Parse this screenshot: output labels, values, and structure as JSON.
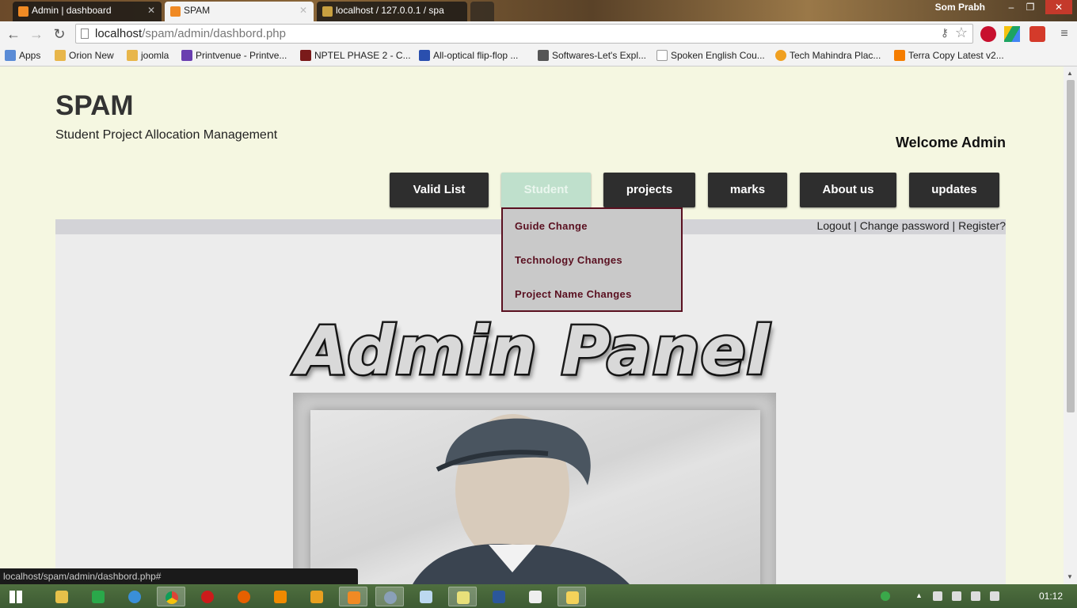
{
  "browser": {
    "tabs": [
      {
        "title": "Admin | dashboard",
        "active": false
      },
      {
        "title": "SPAM",
        "active": true
      },
      {
        "title": "localhost / 127.0.0.1 / spa",
        "active": false
      }
    ],
    "user": "Som Prabh",
    "url_host": "localhost",
    "url_path": "/spam/admin/dashbord.php",
    "bookmarks": [
      "Apps",
      "Orion New",
      "joomla",
      "Printvenue - Printve...",
      "NPTEL PHASE 2 - C...",
      "All-optical flip-flop ...",
      "Softwares-Let's Expl...",
      "Spoken English Cou...",
      "Tech Mahindra Plac...",
      "Terra Copy Latest v2..."
    ],
    "status_url": "localhost/spam/admin/dashbord.php#"
  },
  "site": {
    "title": "SPAM",
    "subtitle": "Student Project Allocation Management",
    "welcome": "Welcome Admin",
    "menu": [
      {
        "label": "Valid List"
      },
      {
        "label": "Student",
        "hovered": true
      },
      {
        "label": "projects"
      },
      {
        "label": "marks"
      },
      {
        "label": "About us"
      },
      {
        "label": "updates"
      }
    ],
    "dropdown": [
      "Guide Change",
      "Technology Changes",
      "Project Name Changes"
    ],
    "account_links": {
      "logout": "Logout",
      "sep": "|",
      "change_password": "Change password",
      "register": "Register?"
    },
    "banner": "Admin Panel"
  },
  "taskbar": {
    "clock": "01:12"
  },
  "colors": {
    "page_bg": "#f5f7e1",
    "menu_bg": "#2e2e2e",
    "menu_hover": "#bfe0cc",
    "dropdown_text": "#5a1020",
    "dropdown_bg": "#c9c9c9"
  }
}
